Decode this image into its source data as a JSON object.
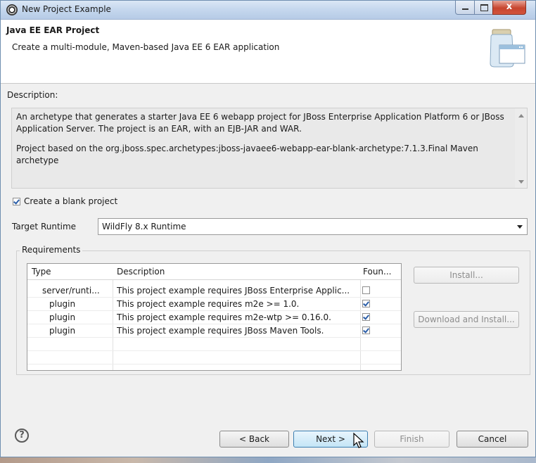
{
  "window": {
    "title": "New Project Example",
    "close_glyph": "x"
  },
  "header": {
    "title": "Java EE EAR Project",
    "subtitle": "Create a multi-module, Maven-based Java EE 6 EAR application",
    "icon": "jar-icon"
  },
  "description": {
    "label": "Description:",
    "paragraph1": "An archetype that generates a starter Java EE 6 webapp project for JBoss Enterprise Application Platform 6 or JBoss Application Server. The project is an EAR, with an EJB-JAR and WAR.",
    "paragraph2": "Project based on the org.jboss.spec.archetypes:jboss-javaee6-webapp-ear-blank-archetype:7.1.3.Final Maven archetype"
  },
  "blank_project": {
    "label": "Create a blank project",
    "checked": true
  },
  "target_runtime": {
    "label": "Target Runtime",
    "value": "WildFly 8.x Runtime"
  },
  "requirements": {
    "label": "Requirements",
    "columns": [
      "Type",
      "Description",
      "Foun..."
    ],
    "rows": [
      {
        "type": "server/runti...",
        "description": "This project example requires JBoss Enterprise Applic...",
        "found": false
      },
      {
        "type": "plugin",
        "description": "This project example requires m2e >= 1.0.",
        "found": true
      },
      {
        "type": "plugin",
        "description": "This project example requires m2e-wtp >= 0.16.0.",
        "found": true
      },
      {
        "type": "plugin",
        "description": "This project example requires JBoss Maven Tools.",
        "found": true
      }
    ],
    "install_label": "Install...",
    "download_install_label": "Download and Install..."
  },
  "footer": {
    "help_glyph": "?",
    "back_label": "< Back",
    "next_label": "Next >",
    "finish_label": "Finish",
    "cancel_label": "Cancel"
  }
}
